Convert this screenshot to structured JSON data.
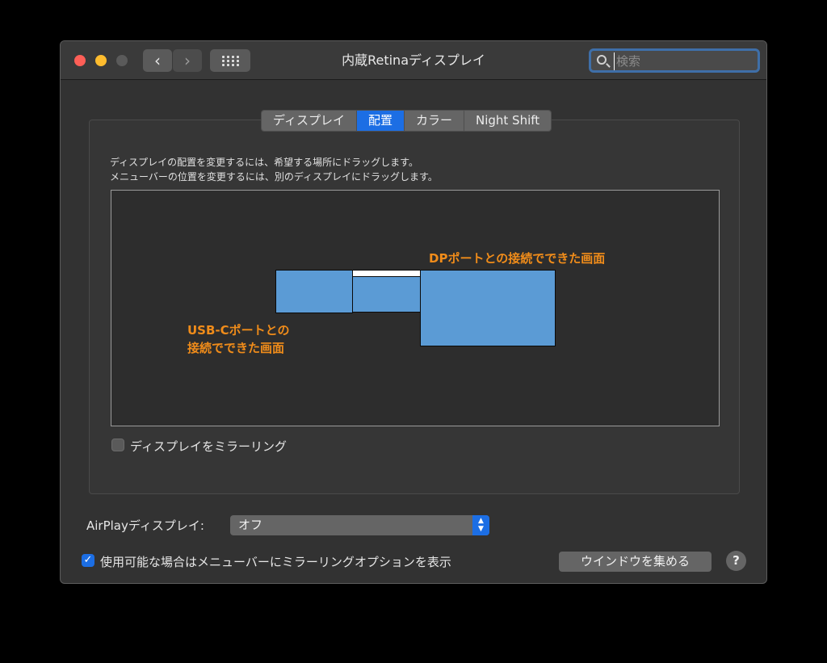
{
  "window": {
    "title": "内蔵Retinaディスプレイ"
  },
  "toolbar": {
    "back_icon": "chevron-left-icon",
    "back_glyph": "‹",
    "forward_icon": "chevron-right-icon",
    "forward_glyph": "›",
    "grid_icon": "show-all-grid-icon"
  },
  "search": {
    "placeholder": "検索",
    "value": ""
  },
  "tabs": [
    {
      "label": "ディスプレイ",
      "active": false
    },
    {
      "label": "配置",
      "active": true
    },
    {
      "label": "カラー",
      "active": false
    },
    {
      "label": "Night Shift",
      "active": false
    }
  ],
  "arrangement": {
    "hint_line1": "ディスプレイの配置を変更するには、希望する場所にドラッグします。",
    "hint_line2": "メニューバーの位置を変更するには、別のディスプレイにドラッグします。",
    "display_color": "#5b9bd5",
    "annotation_color": "#f08c1a",
    "annotation_dp": "DPポートとの接続でできた画面",
    "annotation_usbc_line1": "USB-Cポートとの",
    "annotation_usbc_line2": "接続でできた画面"
  },
  "mirror": {
    "label": "ディスプレイをミラーリング",
    "checked": false
  },
  "airplay": {
    "label": "AirPlayディスプレイ:",
    "value": "オフ",
    "stepper_up": "▲",
    "stepper_down": "▼"
  },
  "menubar_option": {
    "label": "使用可能な場合はメニューバーにミラーリングオプションを表示",
    "checked": true,
    "check_glyph": "✓"
  },
  "buttons": {
    "gather_windows": "ウインドウを集める",
    "help": "?"
  },
  "colors": {
    "accent": "#1c6ee4",
    "close": "#fe5f57",
    "minimize": "#febc2e",
    "zoom_disabled": "#5a5a5a"
  }
}
